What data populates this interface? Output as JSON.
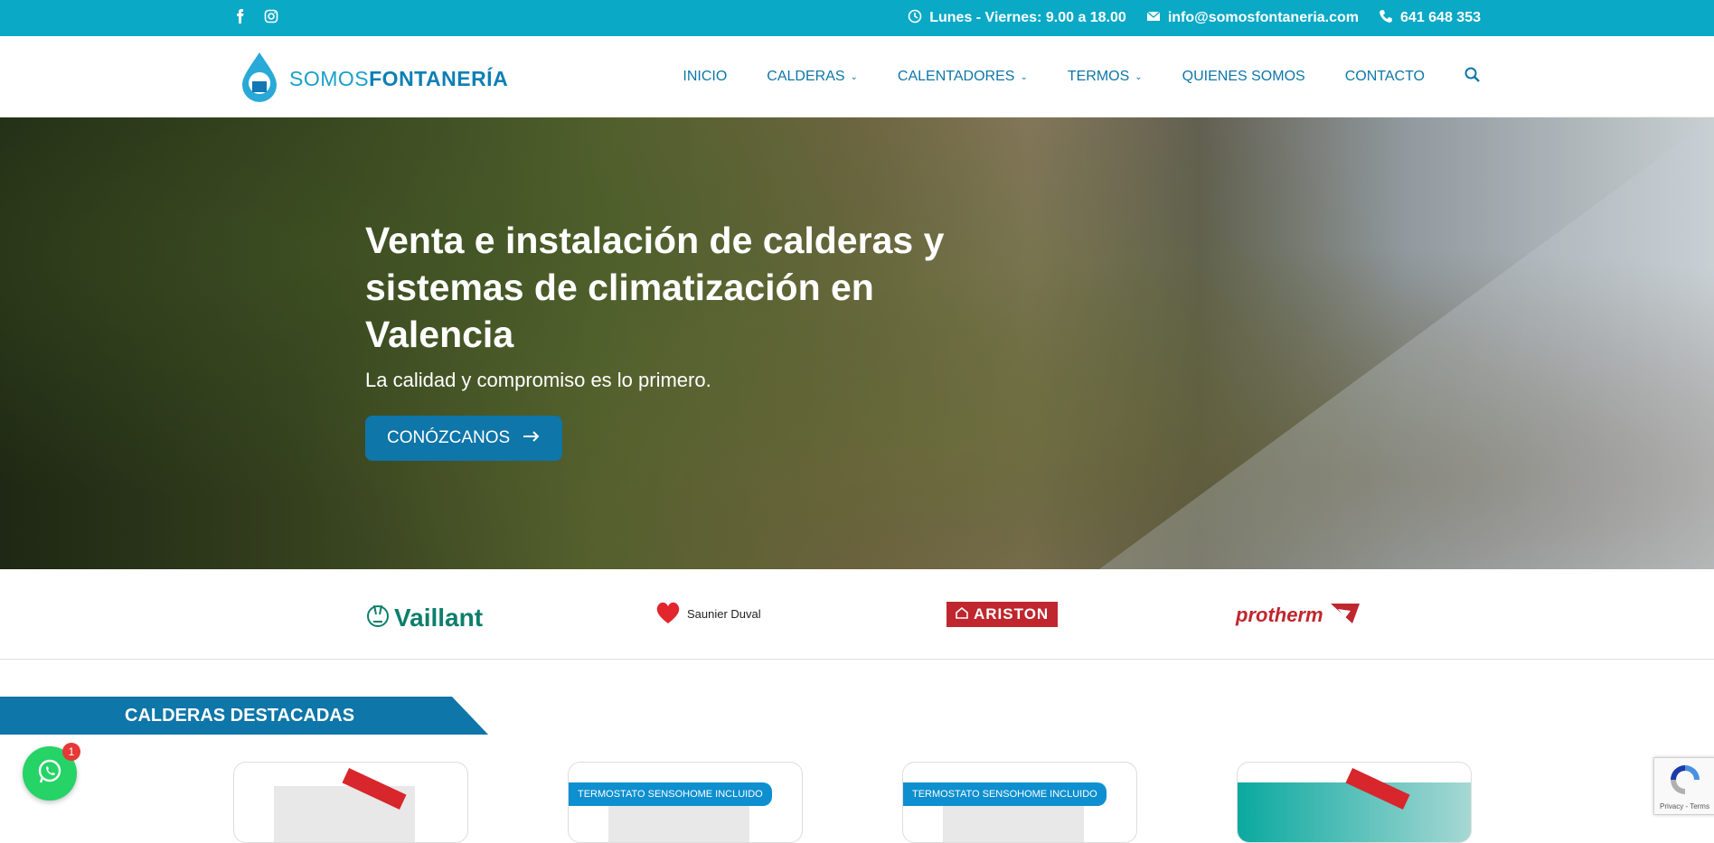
{
  "topbar": {
    "hours": "Lunes - Viernes: 9.00 a 18.00",
    "email": "info@somosfontaneria.com",
    "phone": "641 648 353"
  },
  "header": {
    "logo_part1": "SOMOS",
    "logo_part2": "FONTANERÍA",
    "nav": {
      "inicio": "INICIO",
      "calderas": "CALDERAS",
      "calentadores": "CALENTADORES",
      "termos": "TERMOS",
      "quienes": "QUIENES SOMOS",
      "contacto": "CONTACTO"
    }
  },
  "hero": {
    "title": "Venta e instalación de calderas y sistemas de climatización en Valencia",
    "subtitle": "La calidad y compromiso es lo primero.",
    "cta": "CONÓZCANOS"
  },
  "brands": {
    "vaillant": "Vaillant",
    "saunier": "Saunier Duval",
    "ariston": "ARISTON",
    "protherm": "protherm"
  },
  "section": {
    "title": "CALDERAS DESTACADAS"
  },
  "cards": {
    "ribbon": "TERMOSTATO SENSOHOME INCLUIDO"
  },
  "whatsapp": {
    "badge": "1"
  },
  "recaptcha": {
    "label": "Privacy - Terms"
  },
  "colors": {
    "topbar": "#0aa9c6",
    "primary": "#0e76a8",
    "whatsapp": "#25d366"
  }
}
